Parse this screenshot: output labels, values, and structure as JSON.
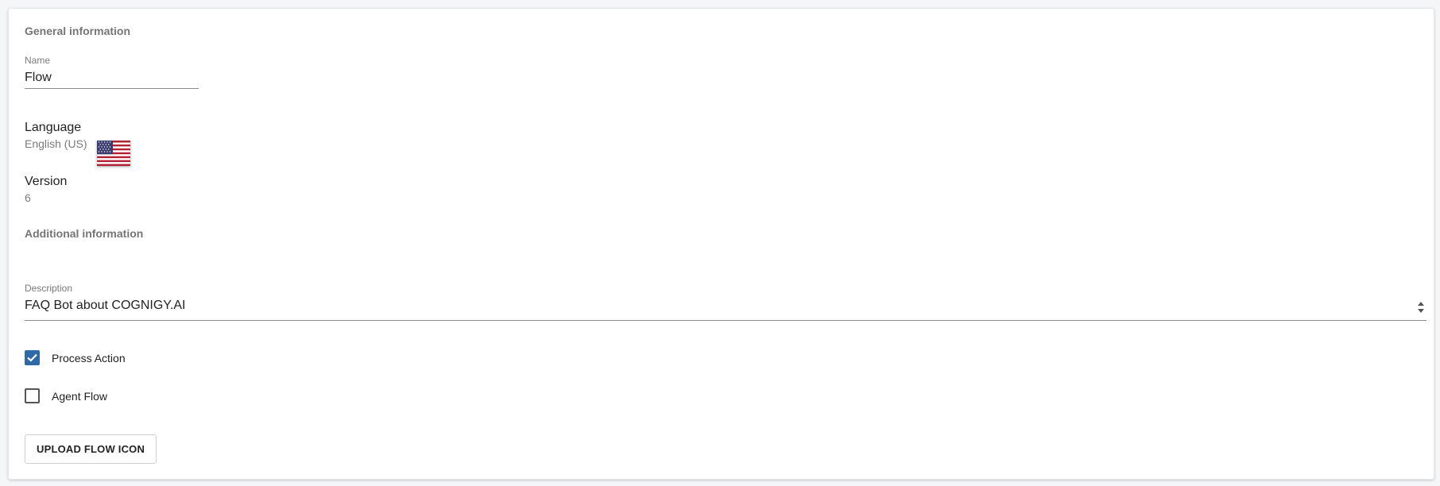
{
  "general": {
    "heading": "General information",
    "name_label": "Name",
    "name_value": "Flow",
    "language_label": "Language",
    "language_value": "English (US)",
    "language_flag_icon": "us-flag-icon",
    "version_label": "Version",
    "version_value": "6"
  },
  "additional": {
    "heading": "Additional information",
    "description_label": "Description",
    "description_value": "FAQ Bot about COGNIGY.AI"
  },
  "options": {
    "process_action_label": "Process Action",
    "process_action_checked": true,
    "agent_flow_label": "Agent Flow",
    "agent_flow_checked": false
  },
  "actions": {
    "upload_label": "UPLOAD FLOW ICON"
  },
  "colors": {
    "accent": "#2f6aa8",
    "muted_text": "#757575"
  }
}
